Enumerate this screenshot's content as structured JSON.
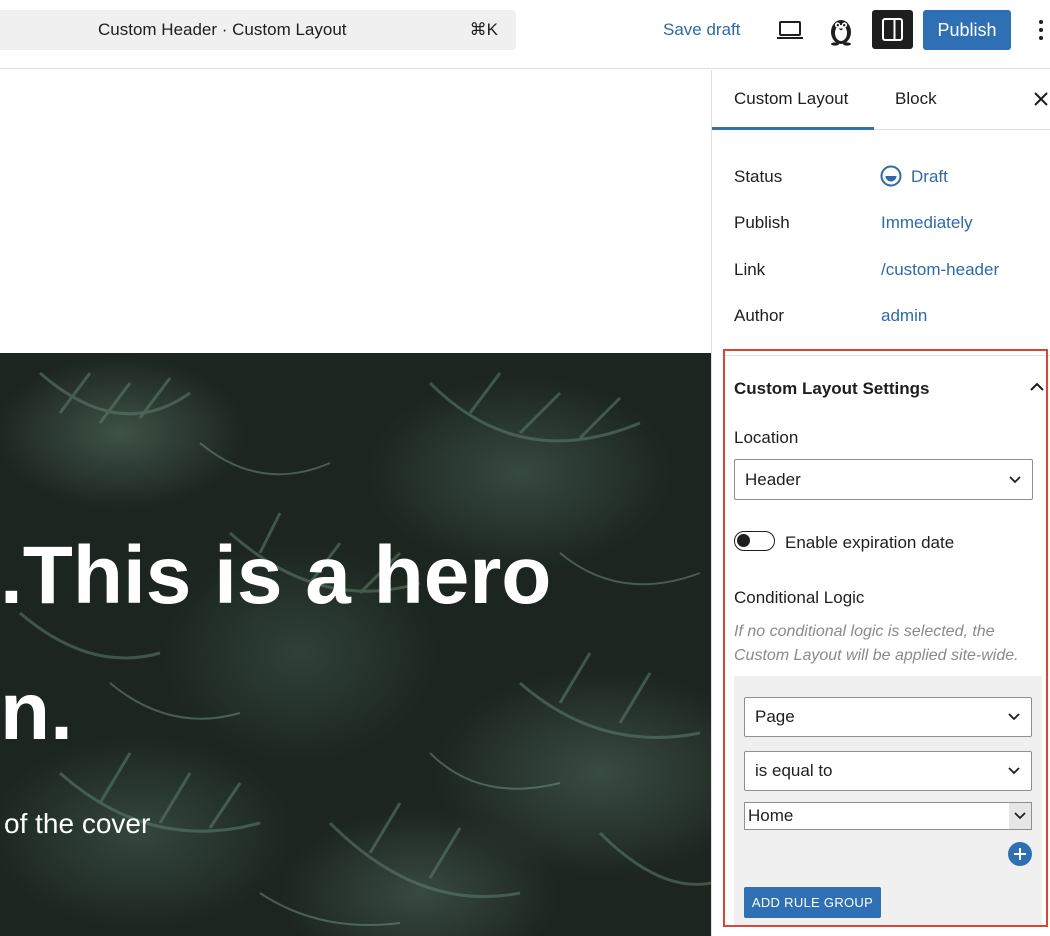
{
  "topbar": {
    "document_title": "Custom Header · Custom Layout",
    "shortcut": "⌘K",
    "save_draft_label": "Save draft",
    "publish_label": "Publish",
    "icons": [
      "desktop-preview-icon",
      "user-avatar-icon",
      "settings-panel-icon",
      "more-options-icon"
    ]
  },
  "hero": {
    "heading_line1": ".This is a hero",
    "heading_line2": "n.",
    "subtext": "of the cover"
  },
  "sidebar": {
    "tabs": [
      {
        "label": "Custom Layout",
        "active": true
      },
      {
        "label": "Block",
        "active": false
      }
    ],
    "summary": {
      "status_label": "Status",
      "status_value": "Draft",
      "publish_label": "Publish",
      "publish_value": "Immediately",
      "link_label": "Link",
      "link_value": "/custom-header",
      "author_label": "Author",
      "author_value": "admin"
    },
    "settings": {
      "title": "Custom Layout Settings",
      "location_label": "Location",
      "location_value": "Header",
      "expiration_label": "Enable expiration date",
      "expiration_enabled": false,
      "conditional_label": "Conditional Logic",
      "conditional_help": "If no conditional logic is selected, the Custom Layout will be applied site-wide.",
      "rule": {
        "subject": "Page",
        "operator": "is equal to",
        "value": "Home"
      },
      "add_rule_group_label": "ADD RULE GROUP"
    }
  },
  "colors": {
    "accent": "#2f70b4",
    "link": "#2d6aa8",
    "highlight_border": "#d9453a",
    "hero_bg": "#1c2520"
  }
}
